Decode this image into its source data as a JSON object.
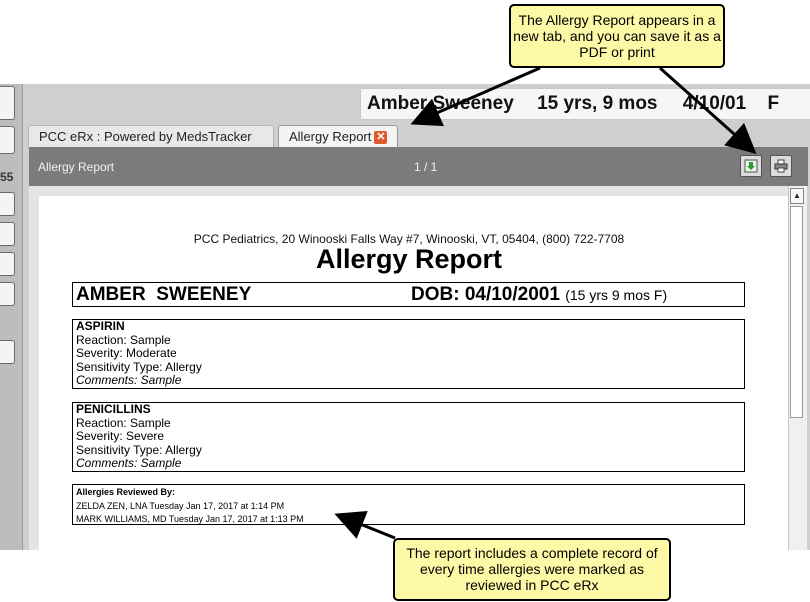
{
  "patient_bar": {
    "name": "Amber Sweeney",
    "age": "15 yrs, 9 mos",
    "dob": "4/10/01",
    "sex": "F"
  },
  "left_strip": {
    "number": "55"
  },
  "tabs": [
    {
      "label": "PCC eRx : Powered by MedsTracker"
    },
    {
      "label": "Allergy Report"
    }
  ],
  "viewer": {
    "title": "Allergy Report",
    "page_count": "1 / 1",
    "download_icon": "download-icon",
    "print_icon": "print-icon"
  },
  "report": {
    "practice_line": "PCC Pediatrics, 20 Winooski Falls Way #7, Winooski, VT, 05404, (800) 722-7708",
    "title": "Allergy Report",
    "patient_name": "AMBER  SWEENEY",
    "dob_label": "DOB: 04/10/2001",
    "dob_extra": "(15 yrs 9 mos F)",
    "allergies": [
      {
        "name": "ASPIRIN",
        "reaction": "Reaction: Sample",
        "severity": "Severity: Moderate",
        "sensitivity": "Sensitivity Type: Allergy",
        "comments": "Comments: Sample"
      },
      {
        "name": "PENICILLINS",
        "reaction": "Reaction: Sample",
        "severity": "Severity: Severe",
        "sensitivity": "Sensitivity Type: Allergy",
        "comments": "Comments: Sample"
      }
    ],
    "reviewed": {
      "heading": "Allergies Reviewed By:",
      "entries": [
        "ZELDA ZEN, LNA Tuesday Jan 17, 2017 at 1:14 PM",
        "MARK WILLIAMS, MD Tuesday Jan 17, 2017 at 1:13 PM"
      ]
    }
  },
  "callouts": {
    "top": "The Allergy Report appears in a new tab, and you can save it as a PDF or print",
    "bottom": "The report includes a complete record of every time allergies were marked as reviewed in PCC eRx"
  },
  "colors": {
    "callout_bg": "#fdf9a6",
    "toolbar_bg": "#7b7b7b",
    "tab_close": "#e05a2a"
  }
}
